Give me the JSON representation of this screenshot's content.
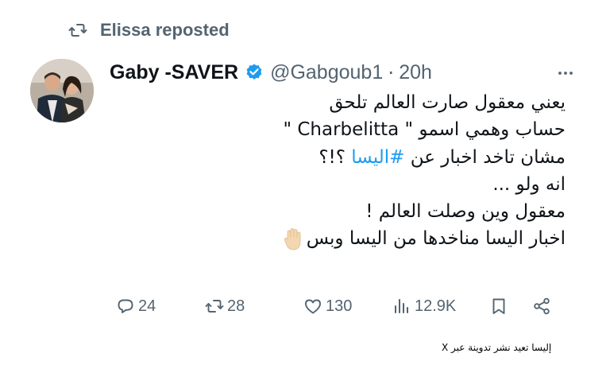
{
  "repost": {
    "icon": "repost-icon",
    "text": "Elissa reposted"
  },
  "tweet": {
    "author": {
      "display_name": "Gaby -SAVER",
      "verified": true,
      "handle": "@Gabgoub1",
      "separator": "·",
      "time": "20h"
    },
    "lines": [
      "يعني معقول صارت العالم تلحق",
      "حساب وهمي اسمو \" Charbelitta \"",
      "مشان تاخد اخبار عن",
      "#اليسا",
      "؟!؟",
      "انه ولو ...",
      "معقول وين وصلت العالم !",
      "اخبار اليسا مناخدها من اليسا وبس"
    ],
    "emoji": "raised-hand-icon"
  },
  "actions": {
    "replies": "24",
    "reposts": "28",
    "likes": "130",
    "views": "12.9K"
  },
  "colors": {
    "accent": "#1d9bf0",
    "muted": "#536471",
    "text": "#0f1419",
    "repost_active": "#536471"
  },
  "caption": "إليسا تعيد نشر تدوينة عبر X"
}
